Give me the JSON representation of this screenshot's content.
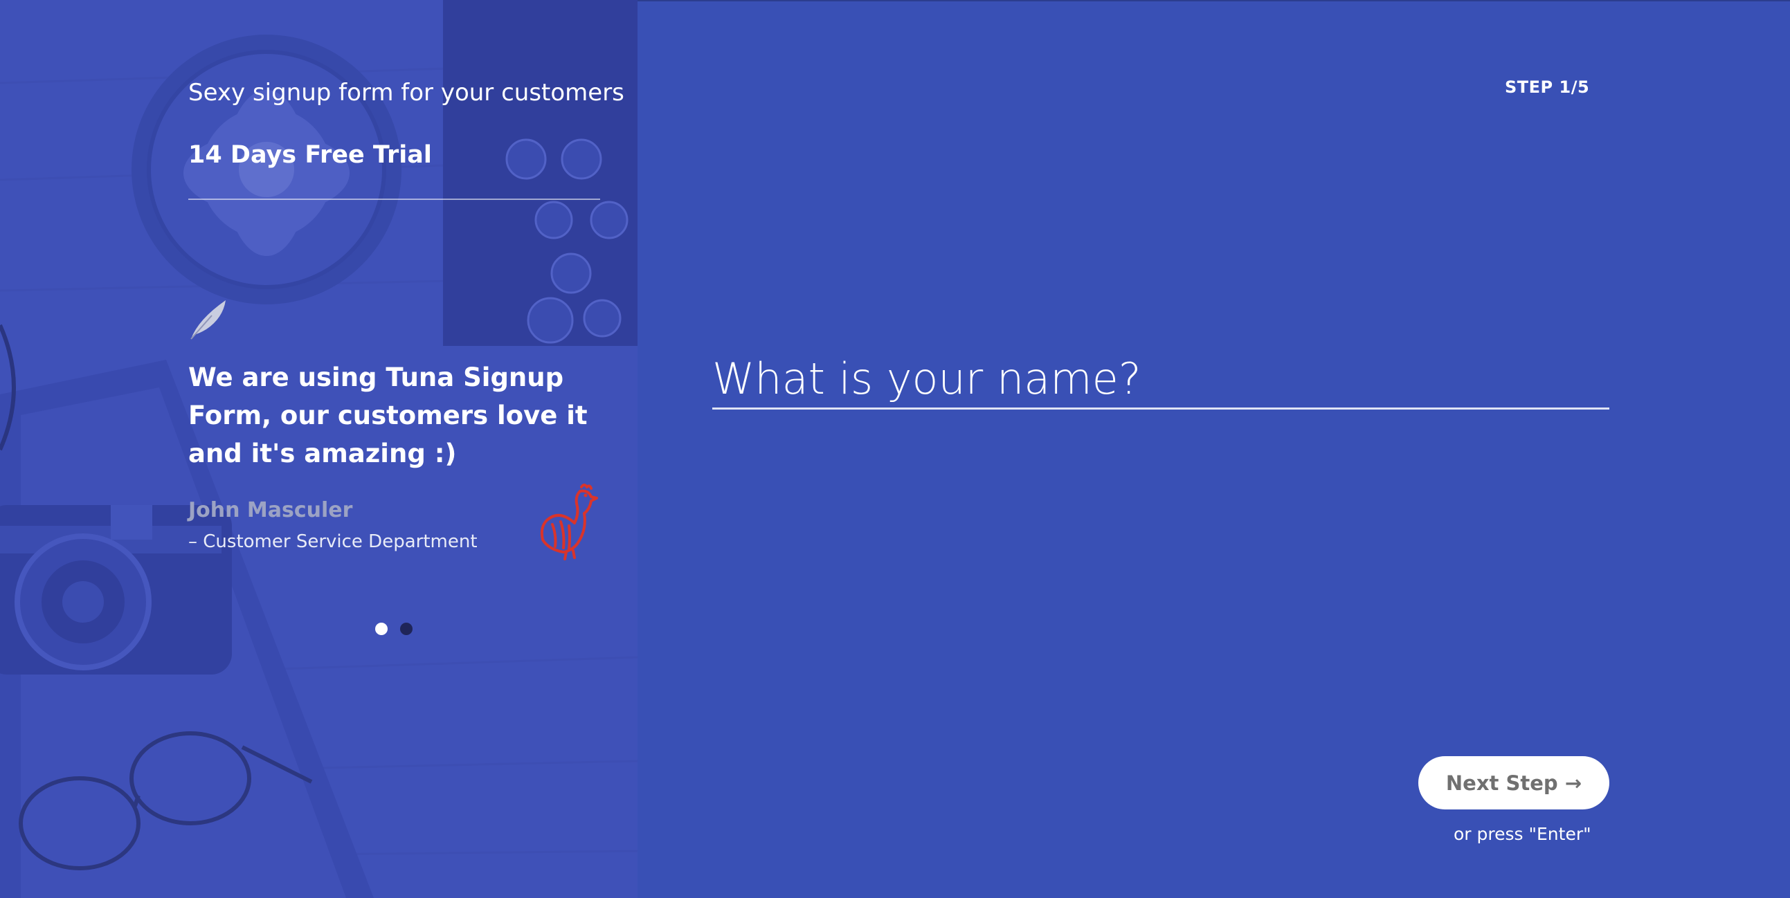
{
  "sidebar": {
    "tagline": "Sexy signup form for your customers",
    "trial_label": "14 Days Free Trial",
    "quote": "We are using Tuna Signup Form, our customers love it and it's amazing :)",
    "author": "John Masculer",
    "department": "– Customer Service Department",
    "carousel": {
      "count": 2,
      "active_index": 0
    }
  },
  "main": {
    "step_label": "STEP 1/5",
    "name_placeholder": "What is your name?",
    "name_value": "",
    "next_button_label": "Next Step →",
    "enter_hint": "or press \"Enter\""
  },
  "colors": {
    "background": "#3950b5",
    "accent_logo": "#d9342b",
    "button_bg": "#ffffff",
    "button_text": "#707070"
  },
  "icons": {
    "quote_icon": "quill-feather-icon",
    "brand_logo": "rooster-icon"
  }
}
